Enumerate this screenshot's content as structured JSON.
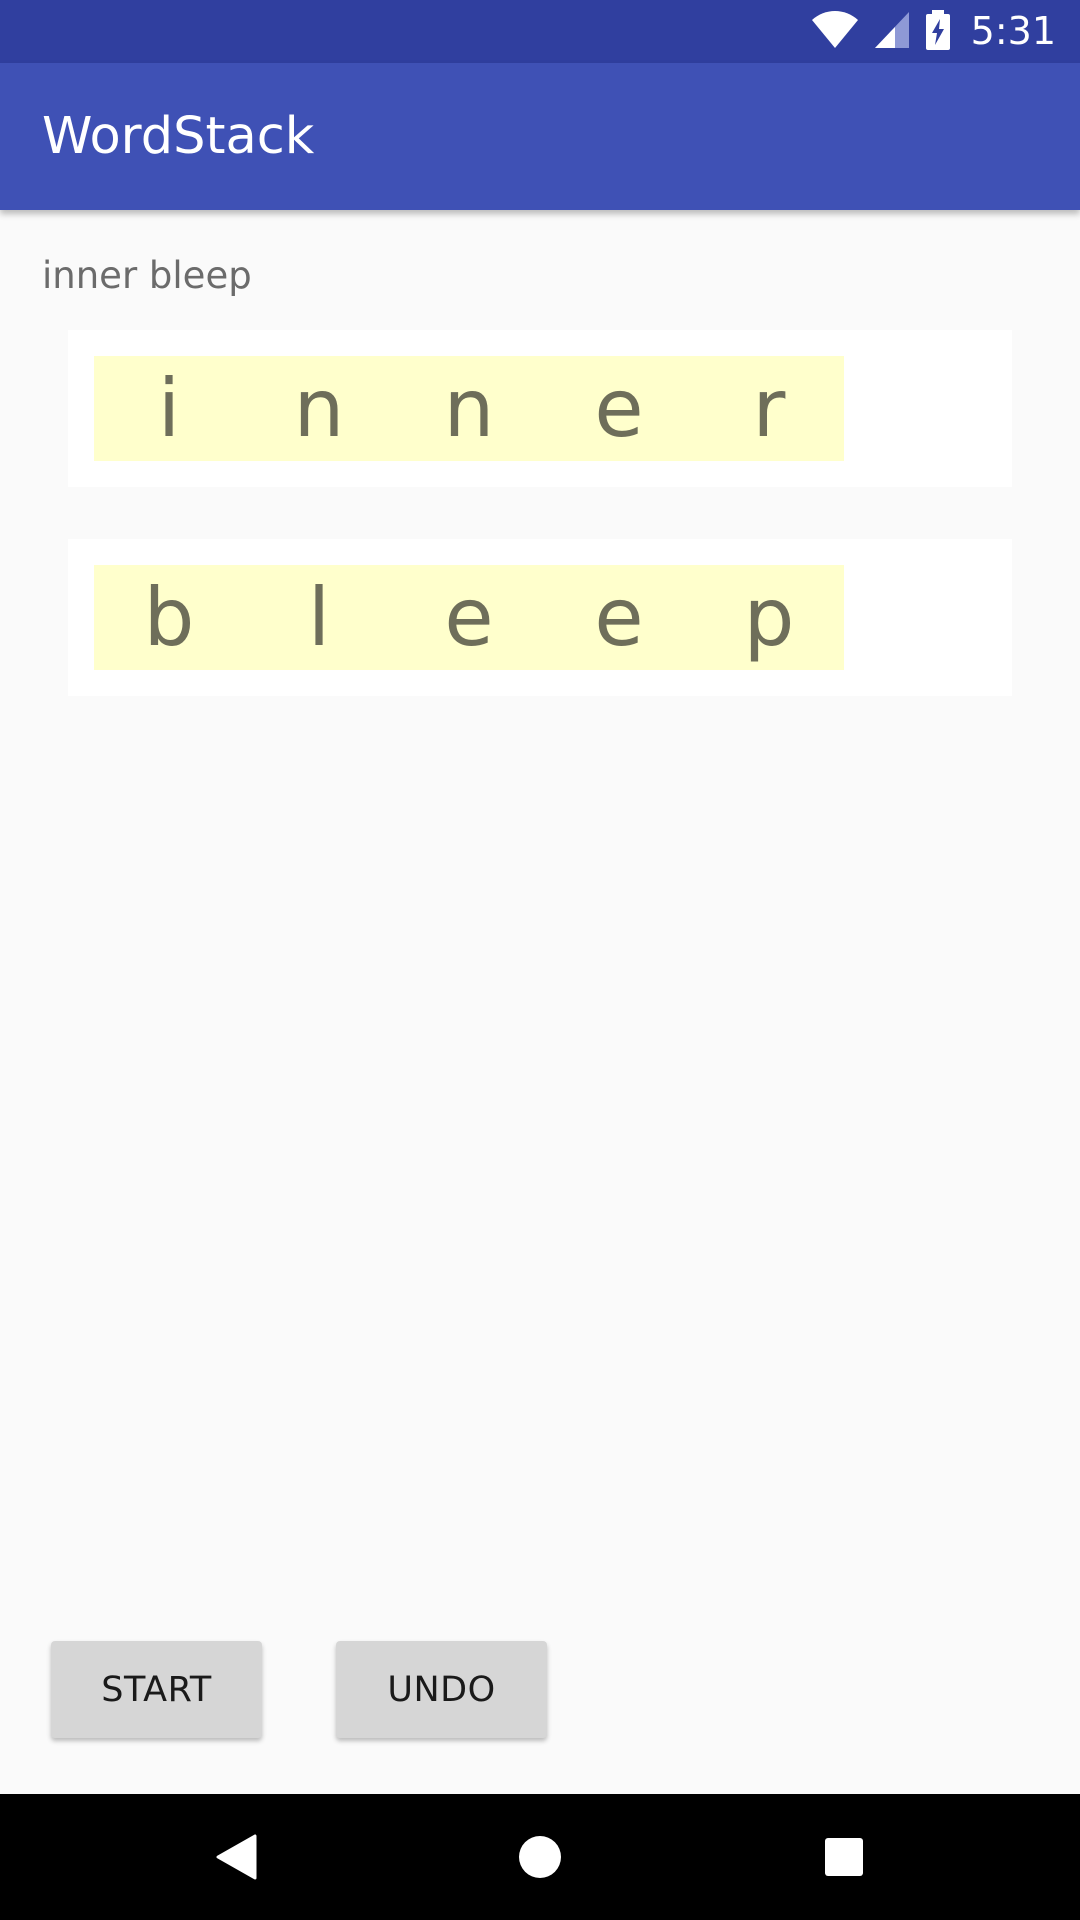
{
  "status_bar": {
    "time": "5:31",
    "icons": [
      "wifi-icon",
      "cell-signal-icon",
      "battery-charging-icon"
    ],
    "color": "#303f9f"
  },
  "app_bar": {
    "title": "WordStack",
    "color": "#3f51b5"
  },
  "main": {
    "hint": "inner bleep",
    "stacks": [
      {
        "letters": [
          "i",
          "n",
          "n",
          "e",
          "r"
        ]
      },
      {
        "letters": [
          "b",
          "l",
          "e",
          "e",
          "p"
        ]
      }
    ],
    "tile_color": "#ffffcc"
  },
  "buttons": {
    "start_label": "START",
    "undo_label": "UNDO"
  },
  "nav_bar": {
    "icons": [
      "back-icon",
      "home-icon",
      "recents-icon"
    ]
  }
}
